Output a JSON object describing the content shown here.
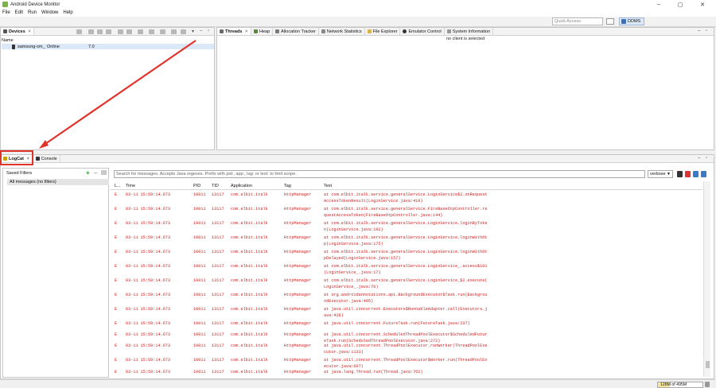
{
  "window": {
    "title": "Android Device Monitor",
    "minimize": "–",
    "maximize": "▢",
    "close": "✕"
  },
  "menu": [
    "File",
    "Edit",
    "Run",
    "Window",
    "Help"
  ],
  "toolbar": {
    "quick_access_placeholder": "Quick Access",
    "perspective_label": "DDMS"
  },
  "devices": {
    "tab_label": "Devices",
    "column_name": "Name",
    "rows": [
      {
        "name": "samsung-sm_",
        "status": "Online",
        "version": "7.0"
      }
    ]
  },
  "tool_tabs": [
    "Threads",
    "Heap",
    "Allocation Tracker",
    "Network Statistics",
    "File Explorer",
    "Emulator Control",
    "System Information"
  ],
  "no_client_text": "no client is selected",
  "logcat": {
    "tab_label": "LogCat",
    "console_label": "Console",
    "saved_filters_label": "Saved Filters",
    "all_messages_label": "All messages (no filters)",
    "search_placeholder": "Search for messages. Accepts Java regexes. Prefix with pid:, app:, tag: or text: to limit scope.",
    "log_level": "verbose",
    "columns": {
      "level": "L...",
      "time": "Time",
      "pid": "PID",
      "tid": "TID",
      "app": "Application",
      "tag": "Tag",
      "text": "Text"
    },
    "rows": [
      {
        "level": "E",
        "time": "03-11 15:59:14.673",
        "pid": "10011",
        "tid": "13117",
        "app": "com.elbit.italk",
        "tag": "HttpManager",
        "text": "at com.elbit.italk.service.generalService.LoginService$2.onRequest AccessTokenResult(LoginService.java:410)"
      },
      {
        "level": "E",
        "time": "03-11 15:59:14.673",
        "pid": "10011",
        "tid": "13117",
        "app": "com.elbit.italk",
        "tag": "HttpManager",
        "text": "at com.elbit.italk.service.generalService.FireBaseOtpController.re questAccessToken(FireBaseOtpController.java:144)"
      },
      {
        "level": "E",
        "time": "03-11 15:59:14.673",
        "pid": "10011",
        "tid": "13117",
        "app": "com.elbit.italk",
        "tag": "HttpManager",
        "text": "at com.elbit.italk.service.generalService.LoginService.loginByToke n(LoginService.java:192)"
      },
      {
        "level": "E",
        "time": "03-11 15:59:14.673",
        "pid": "10011",
        "tid": "13117",
        "app": "com.elbit.italk",
        "tag": "HttpManager",
        "text": "at com.elbit.italk.service.generalService.LoginService.loginWithOt p(LoginService.java:175)"
      },
      {
        "level": "E",
        "time": "03-11 15:59:14.673",
        "pid": "10011",
        "tid": "13117",
        "app": "com.elbit.italk",
        "tag": "HttpManager",
        "text": "at com.elbit.italk.service.generalService.LoginService.loginWithOt pDelayed(LoginService.java:157)"
      },
      {
        "level": "E",
        "time": "03-11 15:59:14.673",
        "pid": "10011",
        "tid": "13117",
        "app": "com.elbit.italk",
        "tag": "HttpManager",
        "text": "at com.elbit.italk.service.generalService.LoginService_.access$101 (LoginService_.java:17)"
      },
      {
        "level": "E",
        "time": "03-11 15:59:14.673",
        "pid": "10011",
        "tid": "13117",
        "app": "com.elbit.italk",
        "tag": "HttpManager",
        "text": "at com.elbit.italk.service.generalService.LoginService_$2.execute( LoginService_.java:70)"
      },
      {
        "level": "E",
        "time": "03-11 15:59:14.673",
        "pid": "10011",
        "tid": "13117",
        "app": "com.elbit.italk",
        "tag": "HttpManager",
        "text": "at org.androidannotations.api.BackgroundExecutor$Task.run(Backgrou ndExecutor.java:405)"
      },
      {
        "level": "E",
        "time": "03-11 15:59:14.673",
        "pid": "10011",
        "tid": "13117",
        "app": "com.elbit.italk",
        "tag": "HttpManager",
        "text": "at java.util.concurrent.Executors$RunnableAdapter.call(Executors.j ava:428)"
      },
      {
        "level": "E",
        "time": "03-11 15:59:14.673",
        "pid": "10011",
        "tid": "13117",
        "app": "com.elbit.italk",
        "tag": "HttpManager",
        "text": "at java.util.concurrent.FutureTask.run(FutureTask.java:237)"
      },
      {
        "level": "E",
        "time": "03-11 15:59:14.673",
        "pid": "10011",
        "tid": "13117",
        "app": "com.elbit.italk",
        "tag": "HttpManager",
        "text": "at java.util.concurrent.ScheduledThreadPoolExecutor$ScheduledFutur eTask.run(ScheduledThreadPoolExecutor.java:272)"
      },
      {
        "level": "E",
        "time": "03-11 15:59:14.673",
        "pid": "10011",
        "tid": "13117",
        "app": "com.elbit.italk",
        "tag": "HttpManager",
        "text": "at java.util.concurrent.ThreadPoolExecutor.runWorker(ThreadPoolExe cutor.java:1133)"
      },
      {
        "level": "E",
        "time": "03-11 15:59:14.673",
        "pid": "10011",
        "tid": "13117",
        "app": "com.elbit.italk",
        "tag": "HttpManager",
        "text": "at java.util.concurrent.ThreadPoolExecutor$Worker.run(ThreadPoolEx ecutor.java:607)"
      },
      {
        "level": "E",
        "time": "03-11 15:59:14.673",
        "pid": "10011",
        "tid": "13117",
        "app": "com.elbit.italk",
        "tag": "HttpManager",
        "text": "at java.lang.Thread.run(Thread.java:762)"
      }
    ]
  },
  "status": {
    "memory_label": "128M of 495M",
    "memory_fraction": 0.26
  },
  "colors": {
    "error_text": "#d02020",
    "selection": "#dbe8f7",
    "highlight": "#e0342b"
  }
}
